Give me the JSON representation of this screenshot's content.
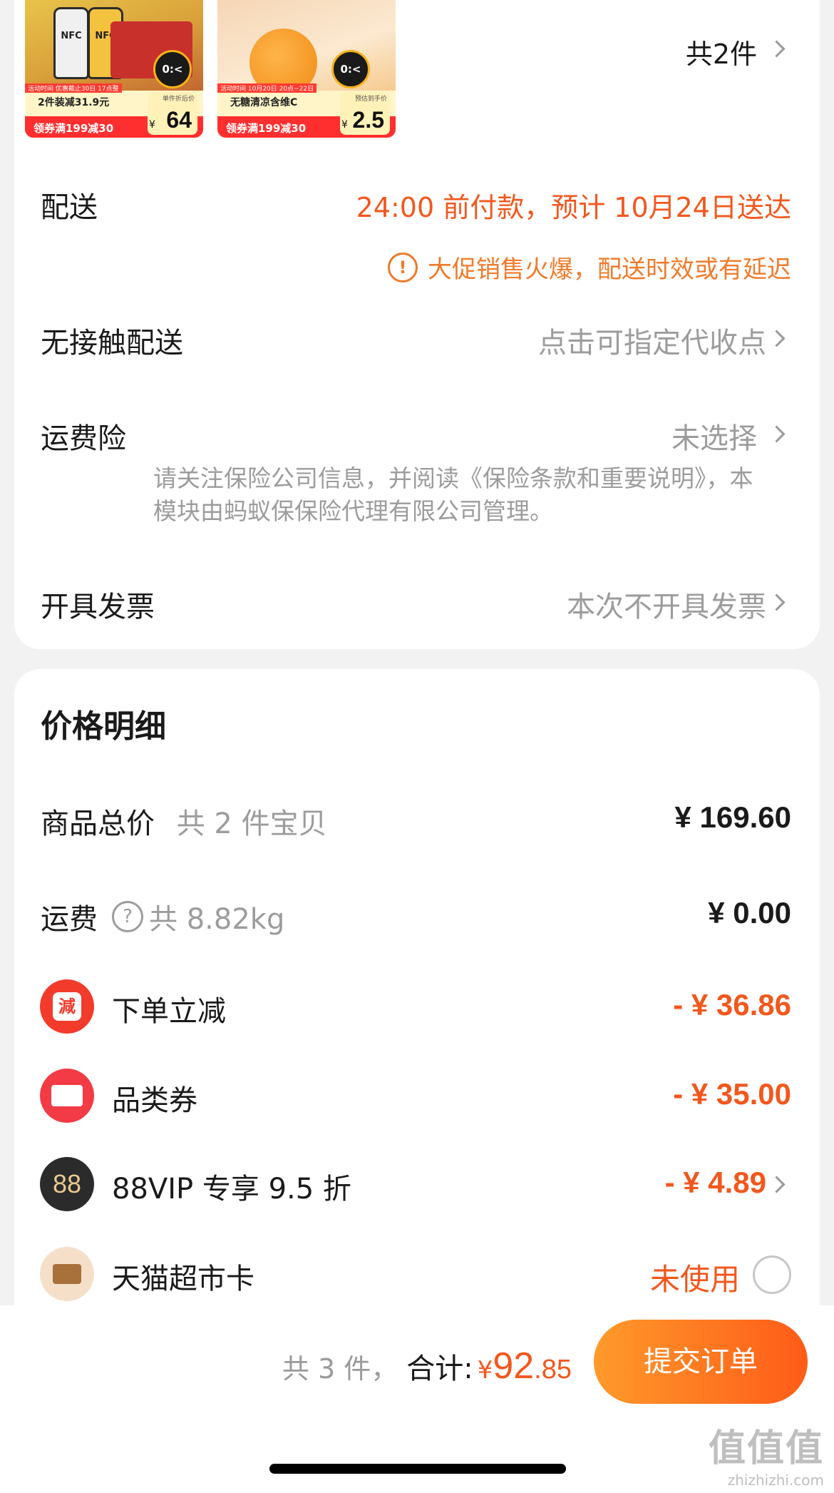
{
  "products": [
    {
      "bottle_label": "NFC",
      "promo_tag": "活动时间 优惠截止30日 17点整",
      "title": "2件装减31.9元",
      "coupon": "领券满199减30",
      "price_label": "单件折后价",
      "price_symbol": "¥",
      "price": "64",
      "badge": "0:<"
    },
    {
      "promo_tag": "活动时间 10月20日 20点~22日",
      "title": "无糖清凉含维C",
      "coupon": "领券满199减30",
      "price_label": "预估到手价",
      "price_symbol": "¥",
      "price": "2.5",
      "badge": "0:<"
    }
  ],
  "item_count": "共2件",
  "delivery": {
    "label": "配送",
    "value": "24:00 前付款，预计 10月24日送达",
    "warning": "大促销售火爆，配送时效或有延迟",
    "warning_icon": "!"
  },
  "contactless": {
    "label": "无接触配送",
    "value": "点击可指定代收点"
  },
  "insurance": {
    "label": "运费险",
    "value": "未选择",
    "note": "请关注保险公司信息，并阅读《保险条款和重要说明》，本模块由蚂蚁保保险代理有限公司管理。"
  },
  "invoice": {
    "label": "开具发票",
    "value": "本次不开具发票"
  },
  "price_detail": {
    "title": "价格明细",
    "goods_total": {
      "label": "商品总价",
      "sub": "共 2 件宝贝",
      "value": "¥ 169.60"
    },
    "shipping": {
      "label": "运费",
      "help_icon": "?",
      "sub": "共 8.82kg",
      "value": "¥ 0.00"
    },
    "discounts": [
      {
        "icon": "jian-icon",
        "icon_text": "減",
        "label": "下单立减",
        "value": "- ¥ 36.86"
      },
      {
        "icon": "coupon-icon",
        "label": "品类券",
        "value": "- ¥ 35.00"
      },
      {
        "icon": "vip-icon",
        "icon_text": "88",
        "label": "88VIP 专享 9.5 折",
        "value": "- ¥ 4.89"
      },
      {
        "icon": "card-icon",
        "label": "天猫超市卡",
        "value": "未使用"
      }
    ]
  },
  "footer": {
    "count": "共 3 件，",
    "total_label": "合计:",
    "currency": "¥",
    "total_int": "92",
    "total_dec": ".85",
    "submit": "提交订单"
  },
  "watermark": {
    "line1": "值值值",
    "line2": "zhizhizhi.com"
  },
  "colors": {
    "accent": "#f2571d",
    "button_start": "#ff9a2b",
    "button_end": "#ff5b18",
    "muted": "#9c9c9c"
  }
}
